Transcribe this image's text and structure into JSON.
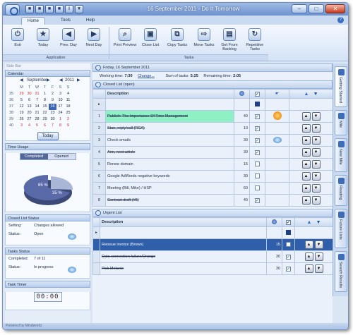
{
  "window": {
    "title": "16 September 2011 - Do It Tomorrow"
  },
  "qat": [
    "■",
    "■",
    "■",
    "■",
    "i",
    "▾"
  ],
  "ribbon": {
    "tabs": [
      {
        "label": "Home"
      },
      {
        "label": "Tools"
      },
      {
        "label": "Help"
      }
    ],
    "groups": [
      {
        "label": "Application"
      },
      {
        "label": "Tasks"
      }
    ],
    "buttons": [
      {
        "label": "Exit",
        "glyph": "⏻"
      },
      {
        "label": "Today",
        "glyph": "★"
      },
      {
        "label": "Prev. Day",
        "glyph": "◀"
      },
      {
        "label": "Next Day",
        "glyph": "▶"
      },
      {
        "label": "Print Preview",
        "glyph": "⌕"
      },
      {
        "label": "Close List",
        "glyph": "▣"
      },
      {
        "label": "Copy Tasks",
        "glyph": "⧉"
      },
      {
        "label": "Move Tasks",
        "glyph": "⇨"
      },
      {
        "label": "Get From Backlog",
        "glyph": "▤"
      },
      {
        "label": "Repetitive Tasks",
        "glyph": "↻"
      }
    ]
  },
  "sidebar": {
    "title": "Side Bar",
    "calendar": {
      "heading": "Calendar",
      "month": "September",
      "year": "2011",
      "weekday_headers": [
        "M",
        "T",
        "W",
        "T",
        "F",
        "S",
        "S"
      ],
      "weeks": [
        "35",
        "36",
        "37",
        "38",
        "39",
        "40"
      ],
      "days": [
        "29",
        "30",
        "31",
        "1",
        "2",
        "3",
        "4",
        "5",
        "6",
        "7",
        "8",
        "9",
        "10",
        "11",
        "12",
        "13",
        "14",
        "15",
        "16",
        "17",
        "18",
        "19",
        "20",
        "21",
        "22",
        "23",
        "24",
        "25",
        "26",
        "27",
        "28",
        "29",
        "30",
        "1",
        "2",
        "3",
        "4",
        "5",
        "6",
        "7",
        "8",
        "9"
      ],
      "today_button": "Today"
    },
    "time_usage": {
      "heading": "Time Usage",
      "legend_completed": "Completed",
      "legend_opened": "Opened",
      "completed_pct": "65 %",
      "opened_pct": "35 %"
    },
    "closed_list_status": {
      "heading": "Closed List Status",
      "setting_label": "Setting:",
      "setting_value": "Changes allowed",
      "status_label": "Status:",
      "status_value": "Open"
    },
    "tasks_status": {
      "heading": "Tasks Status",
      "completed_label": "Completed:",
      "completed_value": "7 of 11",
      "status_label": "Status:",
      "status_value": "In progress"
    },
    "task_timer": {
      "heading": "Task Timer",
      "value": "00:00"
    }
  },
  "main": {
    "date_bar": "Friday, 16 September 2011",
    "working_time_label": "Working time:",
    "working_time_value": "7:30",
    "change_link": "Change...",
    "sum_label": "Sum of tasks:",
    "sum_value": "5:25",
    "remaining_label": "Remaining time:",
    "remaining_value": "2:05",
    "closed_list": {
      "title": "Closed List (open)",
      "header_description": "Description",
      "rows": [
        {
          "num": "1",
          "desc": "Publish: The Importance Of Time Management",
          "minutes": "40",
          "done": true,
          "strike": true
        },
        {
          "num": "2",
          "desc": "Stan, reply/call (RCA)",
          "minutes": "10",
          "done": true,
          "strike": true
        },
        {
          "num": "3",
          "desc": "Check emails",
          "minutes": "30",
          "done": true,
          "strike": false
        },
        {
          "num": "4",
          "desc": "Ann, next article",
          "minutes": "30",
          "done": true,
          "strike": true
        },
        {
          "num": "5",
          "desc": "Renew domain",
          "minutes": "15",
          "done": false,
          "strike": false
        },
        {
          "num": "6",
          "desc": "Google AdWords negative keywords",
          "minutes": "30",
          "done": false,
          "strike": false
        },
        {
          "num": "7",
          "desc": "Meeting (Bill, Mike) / HSP",
          "minutes": "60",
          "done": false,
          "strike": false
        },
        {
          "num": "8",
          "desc": "Contract draft (#5)",
          "minutes": "40",
          "done": true,
          "strike": true
        }
      ]
    },
    "urgent_list": {
      "title": "Urgent List",
      "header_description": "Description",
      "rows": [
        {
          "desc": "Reissue invoice (Brown)",
          "minutes": "15",
          "done": false
        },
        {
          "desc": "Data connection failure/Orange",
          "minutes": "30",
          "done": true
        },
        {
          "desc": "Pick Melanie",
          "minutes": "30",
          "done": true
        }
      ]
    }
  },
  "right_tabs": [
    {
      "label": "Getting Started"
    },
    {
      "label": "Mile"
    },
    {
      "label": "New Mile"
    },
    {
      "label": "Reading"
    },
    {
      "label": "Future Lists"
    },
    {
      "label": "Search Results"
    }
  ],
  "statusbar": {
    "text": "Powered by Mindworkz"
  },
  "colors": {
    "accent": "#2f5eaa",
    "highlight_row": "#8ff0c6",
    "chrome": "#dbe6f5"
  }
}
